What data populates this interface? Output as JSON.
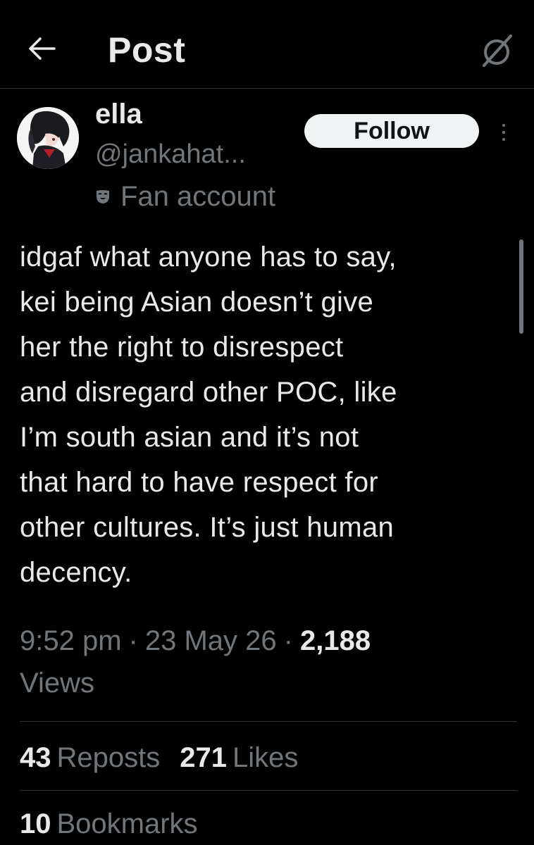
{
  "header": {
    "title": "Post",
    "back_icon": "arrow-left-icon",
    "grok_icon": "grok-icon"
  },
  "author": {
    "display_name": "ella",
    "handle": "@jankahat...",
    "label": "Fan account",
    "label_icon": "theater-mask-icon",
    "follow_label": "Follow",
    "more_icon": "more-vertical-icon"
  },
  "post": {
    "lines": [
      "idgaf what anyone has to say,",
      "kei being Asian doesn’t give",
      "her the right to disrespect",
      "and disregard other POC, like",
      "I’m south asian and it’s not",
      "that hard to have respect for",
      "other cultures. It’s just human",
      "decency."
    ]
  },
  "meta": {
    "time": "9:52 pm",
    "separator": "·",
    "date": "23 May 26",
    "views_count": "2,188",
    "views_label": "Views"
  },
  "stats": {
    "reposts_count": "43",
    "reposts_label": "Reposts",
    "likes_count": "271",
    "likes_label": "Likes",
    "bookmarks_count": "10",
    "bookmarks_label": "Bookmarks"
  },
  "colors": {
    "background": "#000000",
    "text_primary": "#e7e9ea",
    "text_secondary": "#71767b",
    "divider": "#2f3336",
    "follow_button_bg": "#eff3f4"
  }
}
